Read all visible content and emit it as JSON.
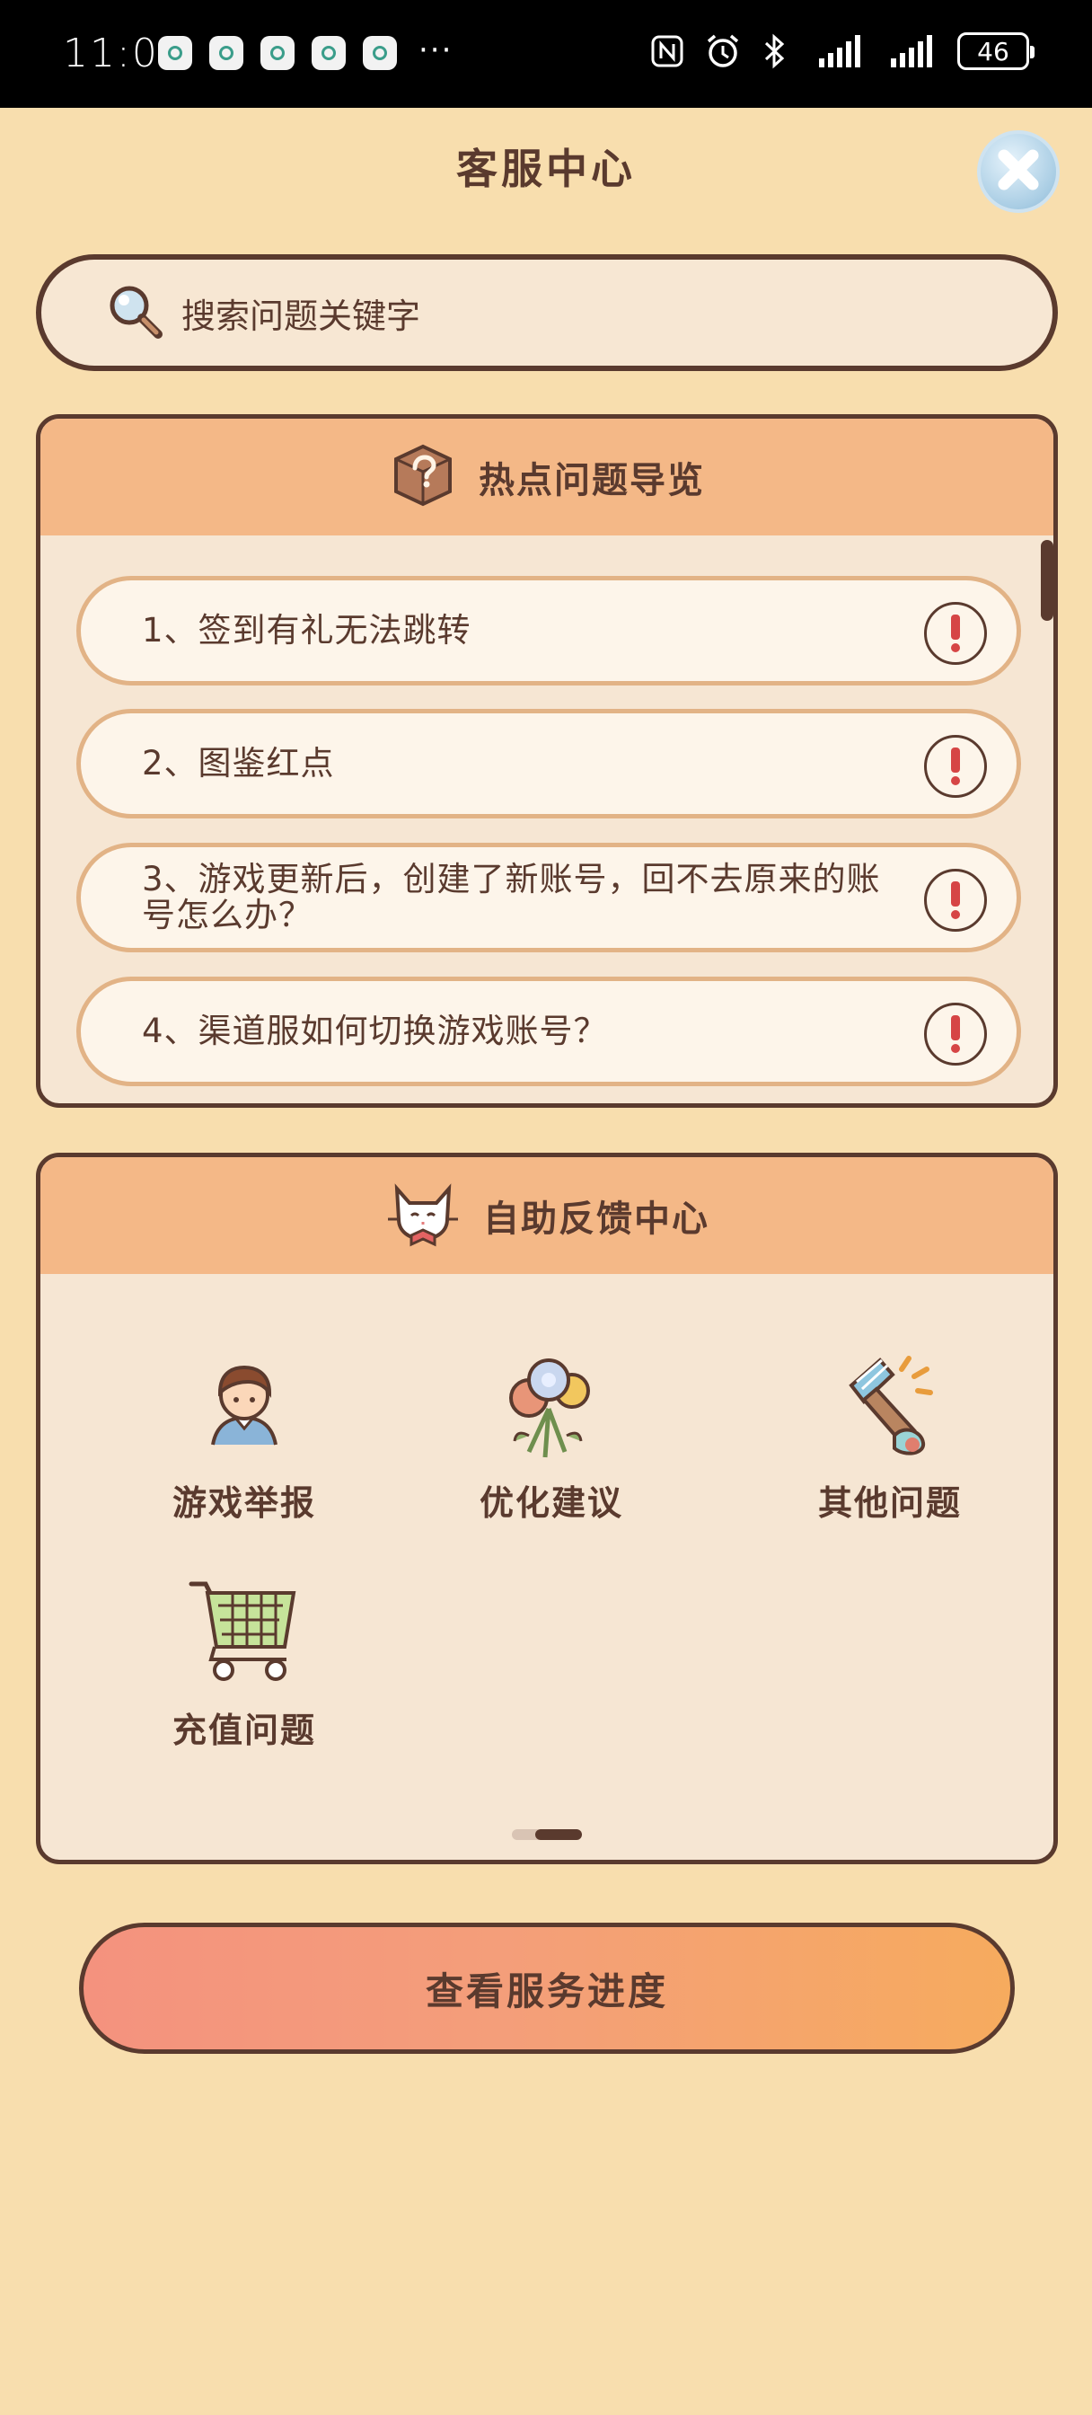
{
  "status_bar": {
    "time": "11:02",
    "more": "···",
    "battery": "46"
  },
  "header": {
    "title": "客服中心"
  },
  "search": {
    "placeholder": "搜索问题关键字"
  },
  "hot_questions": {
    "title": "热点问题导览",
    "items": [
      {
        "text": "1、签到有礼无法跳转"
      },
      {
        "text": "2、图鉴红点"
      },
      {
        "text": "3、游戏更新后，创建了新账号，回不去原来的账号怎么办？"
      },
      {
        "text": "4、渠道服如何切换游戏账号？"
      }
    ]
  },
  "feedback": {
    "title": "自助反馈中心",
    "items": [
      {
        "label": "游戏举报",
        "icon": "user-avatar-icon"
      },
      {
        "label": "优化建议",
        "icon": "flower-bouquet-icon"
      },
      {
        "label": "其他问题",
        "icon": "paint-brush-icon"
      },
      {
        "label": "充值问题",
        "icon": "shopping-cart-icon"
      }
    ]
  },
  "progress_button": {
    "label": "查看服务进度"
  },
  "colors": {
    "background": "#f8deae",
    "text": "#5a3a2e",
    "card_header": "#f4b887",
    "card_body": "#f6e6d3"
  }
}
